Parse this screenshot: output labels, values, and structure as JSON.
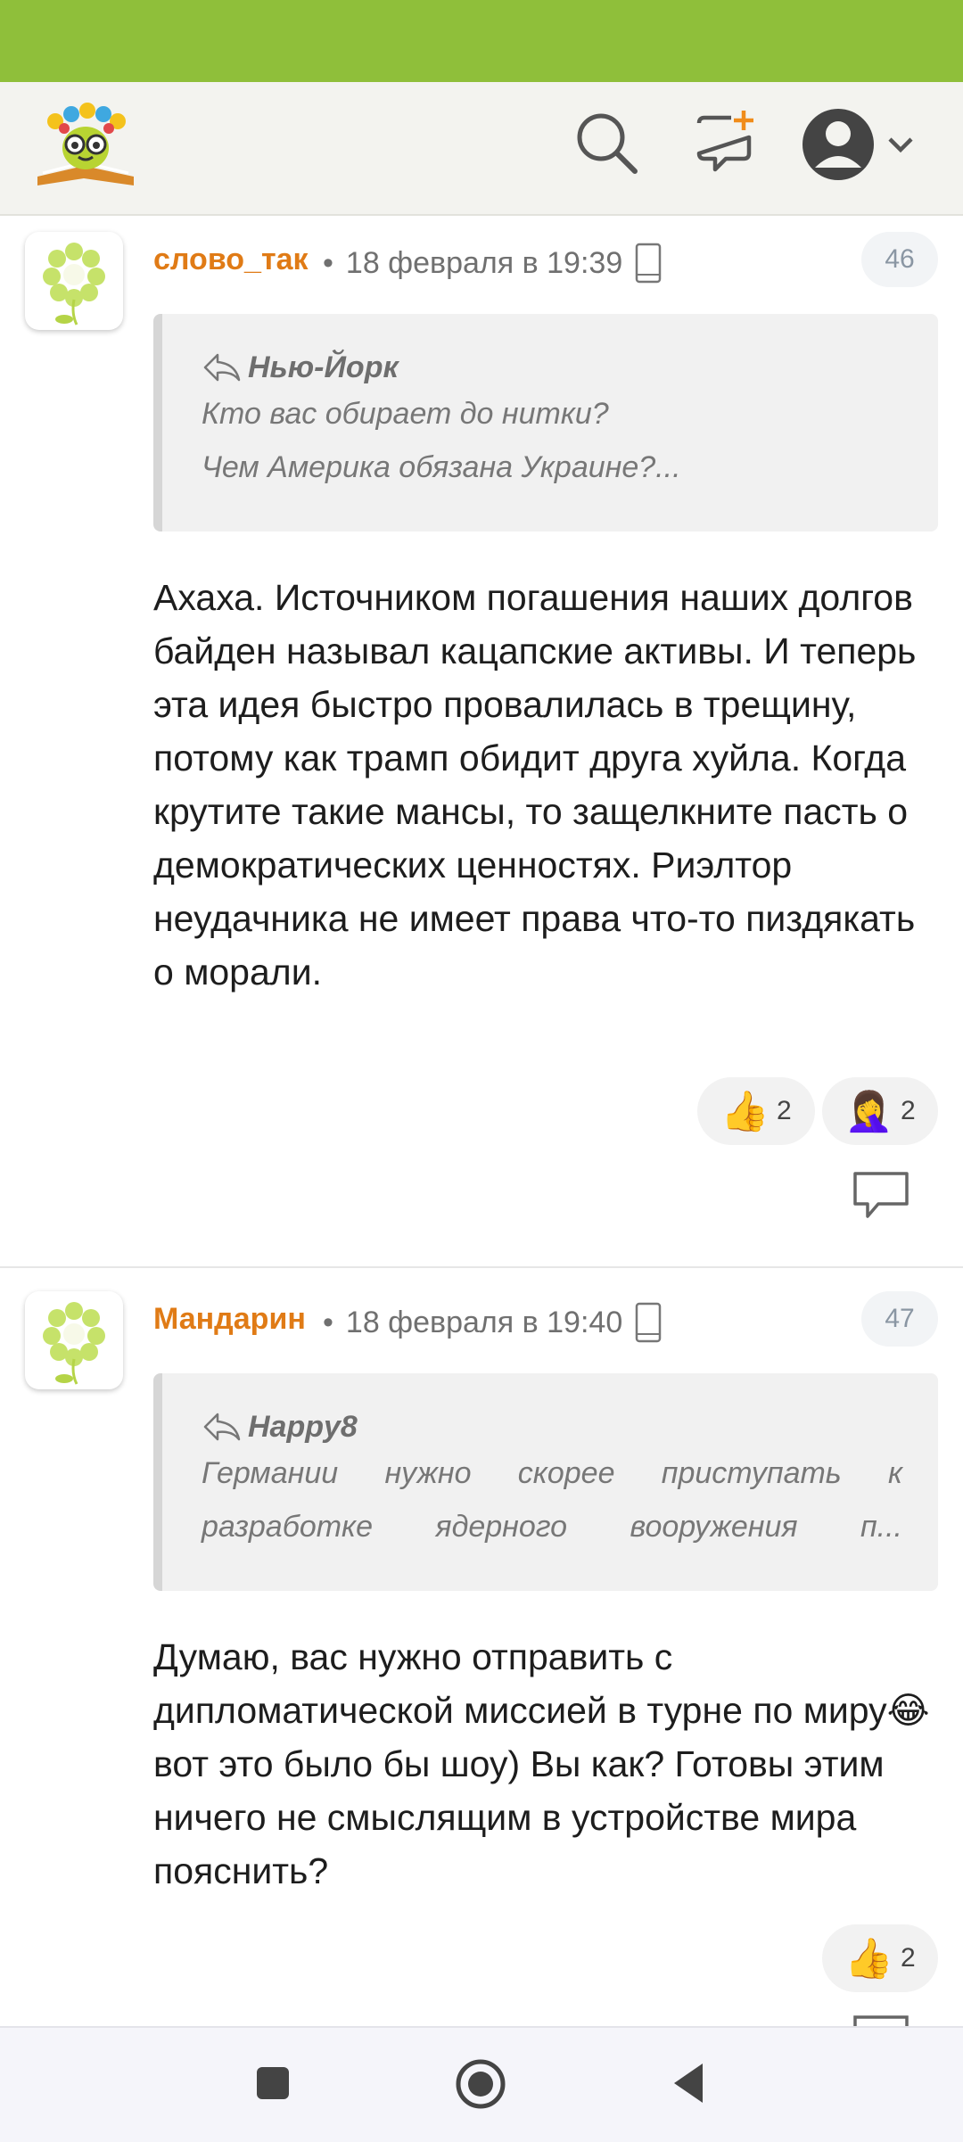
{
  "comments": [
    {
      "author": "слово_так",
      "dot": "•",
      "timestamp": "18 февраля в 19:39",
      "number": "46",
      "quote": {
        "author": "Нью-Йорк",
        "line1": "Кто вас обирает до нитки?",
        "line2": "Чем Америка обязана Украине?..."
      },
      "text": "Ахаха. Источником погашения наших долгов байден называл кацапские активы. И теперь эта идея быстро провалилась в трещину, потому как трамп обидит друга хуйла. Когда крутите такие мансы, то защелкните пасть о демократических ценностях. Риэлтор неудачника не имеет права что-то пиздякать о морали.",
      "reactions": [
        {
          "emoji": "👍",
          "count": "2",
          "icon": "thumbs-up"
        },
        {
          "emoji": "🤦‍♀️",
          "count": "2",
          "icon": "facepalm"
        }
      ]
    },
    {
      "author": "Мандарин",
      "dot": "•",
      "timestamp": "18 февраля в 19:40",
      "number": "47",
      "quote": {
        "author": "Happy8",
        "line1_words": [
          "Германии",
          "нужно",
          "скорее",
          "приступать",
          "к"
        ],
        "line2_words": [
          "разработке",
          "ядерного",
          "вооружения",
          "п..."
        ]
      },
      "text": "Думаю, вас нужно отправить с дипломатической миссией в турне по миру😂 вот это было бы шоу) Вы как? Готовы этим ничего не смыслящим в устройстве мира пояснить?",
      "reactions": [
        {
          "emoji": "👍",
          "count": "2",
          "icon": "thumbs-up"
        }
      ]
    }
  ],
  "colors": {
    "status_bar": "#8fbf3a",
    "author": "#e07b16",
    "header_bg": "#f3f3ef"
  },
  "icons": [
    "logo",
    "search-icon",
    "new-message-icon",
    "user-avatar-icon",
    "chevron-down-icon",
    "phone-icon",
    "reply-arrow-icon",
    "comment-reply-icon",
    "stop-icon",
    "home-icon",
    "back-icon"
  ]
}
